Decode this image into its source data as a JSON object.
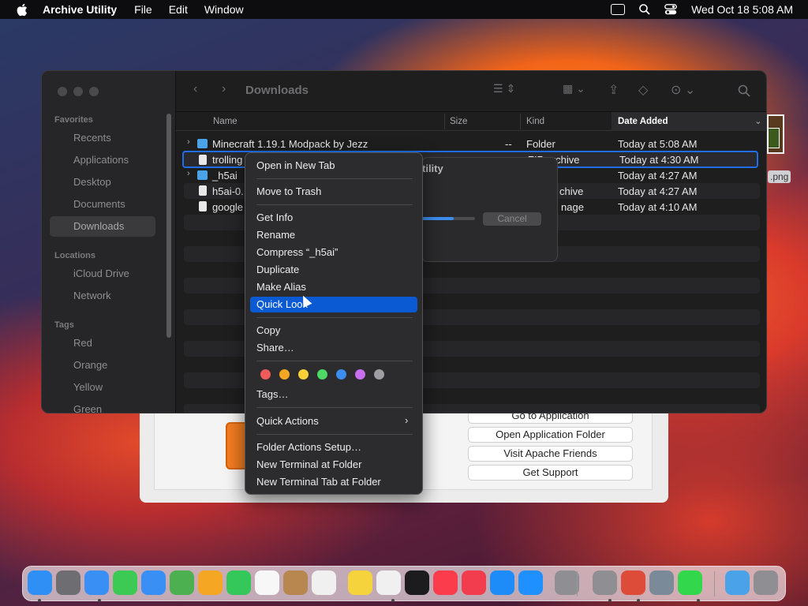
{
  "menubar": {
    "app": "Archive Utility",
    "items": [
      "File",
      "Edit",
      "Window"
    ],
    "clock": "Wed Oct 18  5:08 AM"
  },
  "finder": {
    "title": "Downloads",
    "sidebar": {
      "favorites_header": "Favorites",
      "favorites": [
        "Recents",
        "Applications",
        "Desktop",
        "Documents",
        "Downloads"
      ],
      "locations_header": "Locations",
      "locations": [
        "iCloud Drive",
        "Network"
      ],
      "tags_header": "Tags",
      "tags": [
        "Red",
        "Orange",
        "Yellow",
        "Green"
      ]
    },
    "columns": [
      "Name",
      "Size",
      "Kind",
      "Date Added"
    ],
    "rows": [
      {
        "name": "Minecraft 1.19.1 Modpack by Jezz",
        "size": "--",
        "kind": "Folder",
        "date": "Today at 5:08 AM"
      },
      {
        "name": "trolling",
        "size": "",
        "kind": "ZIP archive",
        "date": "Today at 4:30 AM"
      },
      {
        "name": "_h5ai",
        "size": "",
        "kind": "",
        "date": "Today at 4:27 AM"
      },
      {
        "name": "h5ai-0.",
        "size": "",
        "kind": "chive",
        "date": "Today at 4:27 AM"
      },
      {
        "name": "google",
        "size": "",
        "kind": "nage",
        "date": "Today at 4:10 AM"
      }
    ]
  },
  "dialog": {
    "title": "tility",
    "cancel": "Cancel",
    "progress": 0.6
  },
  "context_menu": {
    "items": [
      "Open in New Tab",
      "Move to Trash",
      "Get Info",
      "Rename",
      "Compress “_h5ai”",
      "Duplicate",
      "Make Alias",
      "Quick Look",
      "Copy",
      "Share…",
      "Tags…",
      "Quick Actions",
      "Folder Actions Setup…",
      "New Terminal at Folder",
      "New Terminal Tab at Folder"
    ],
    "highlighted": "Quick Look",
    "tag_colors": [
      "#ef5b5b",
      "#f5a623",
      "#f7d038",
      "#4cd964",
      "#3b8ef0",
      "#c86ff0",
      "#9e9ea3"
    ]
  },
  "xampp": {
    "buttons": [
      "Go to Application",
      "Open Application Folder",
      "Visit Apache Friends",
      "Get Support"
    ]
  },
  "desktop": {
    "file_label": ".png"
  },
  "dock": {
    "colors": [
      "#2f8ff5",
      "#6d6d72",
      "#3a8ff5",
      "#3cc954",
      "#3a8ff5",
      "#4caf50",
      "#f5a623",
      "#34c759",
      "#f7f7f7",
      "#b8864f",
      "#f0f0f0",
      "#f5d33c",
      "#f0f0f0",
      "#1c1c1e",
      "#fa3c4c",
      "#f23d4f",
      "#1d8cf8",
      "#1e90ff",
      "#8e8e93",
      "#8e8e93",
      "#dd4b39",
      "#7a8a99",
      "#32d74b",
      "#4aa3e8",
      "#8e8e93"
    ]
  }
}
